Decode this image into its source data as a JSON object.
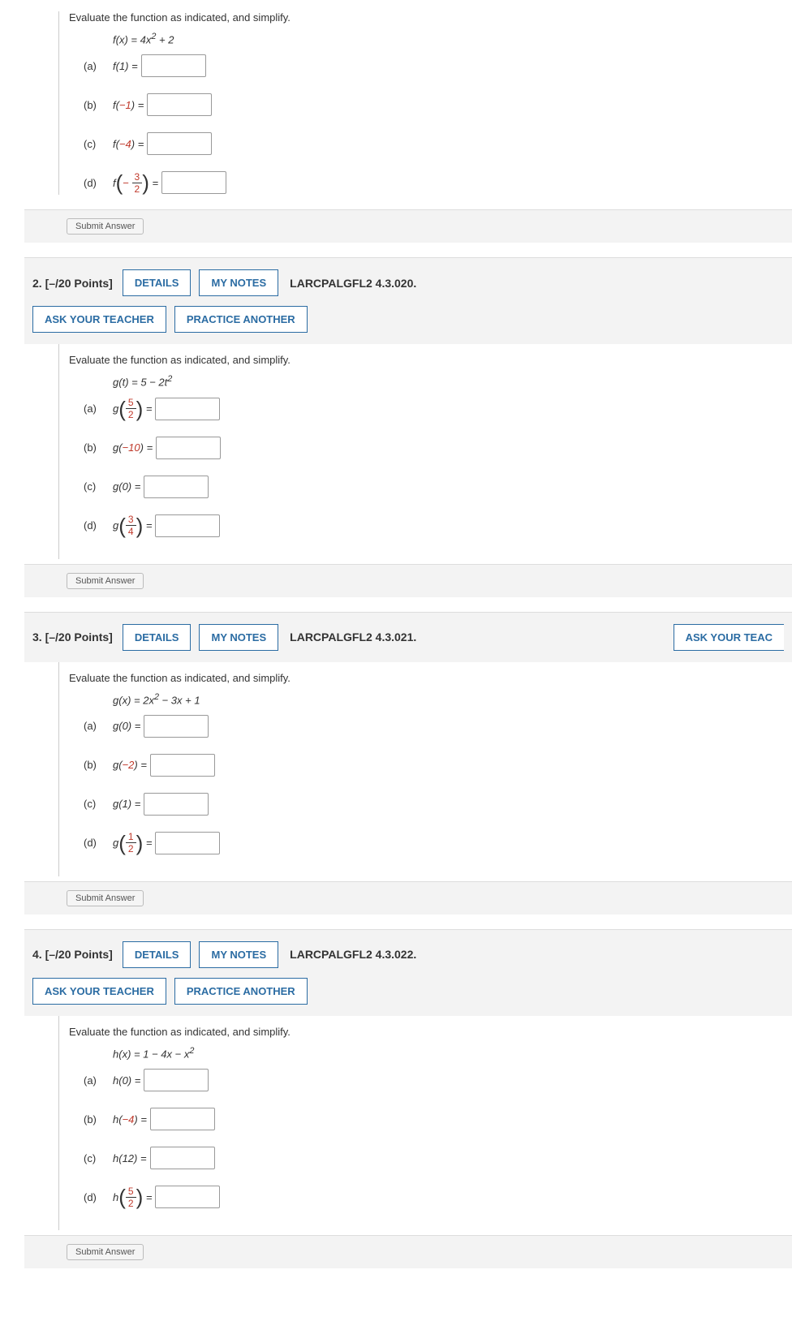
{
  "q1": {
    "intro": "Evaluate the function as indicated, and simplify.",
    "func_html": "f(x) = 4x² + 2",
    "a": "(a)",
    "a_expr": "f(1) =",
    "b": "(b)",
    "b_expr": "f(−1) =",
    "c": "(c)",
    "c_expr": "f(−4) =",
    "d": "(d)",
    "d_f": "f",
    "d_num": "3",
    "d_den": "2",
    "submit": "Submit Answer"
  },
  "q2": {
    "num": "2.",
    "points": "[–/20 Points]",
    "details": "DETAILS",
    "mynotes": "MY NOTES",
    "ref": "LARCPALGFL2 4.3.020.",
    "ask": "ASK YOUR TEACHER",
    "practice": "PRACTICE ANOTHER",
    "intro": "Evaluate the function as indicated, and simplify.",
    "func": "g(t) = 5 − 2t²",
    "a": "(a)",
    "a_g": "g",
    "a_num": "5",
    "a_den": "2",
    "b": "(b)",
    "b_expr": "g(−10) =",
    "c": "(c)",
    "c_expr": "g(0) =",
    "d": "(d)",
    "d_g": "g",
    "d_num": "3",
    "d_den": "4",
    "submit": "Submit Answer"
  },
  "q3": {
    "num": "3.",
    "points": "[–/20 Points]",
    "details": "DETAILS",
    "mynotes": "MY NOTES",
    "ref": "LARCPALGFL2 4.3.021.",
    "ask": "ASK YOUR TEAC",
    "intro": "Evaluate the function as indicated, and simplify.",
    "func": "g(x) = 2x² − 3x + 1",
    "a": "(a)",
    "a_expr": "g(0) =",
    "b": "(b)",
    "b_expr": "g(−2) =",
    "c": "(c)",
    "c_expr": "g(1) =",
    "d": "(d)",
    "d_g": "g",
    "d_num": "1",
    "d_den": "2",
    "submit": "Submit Answer"
  },
  "q4": {
    "num": "4.",
    "points": "[–/20 Points]",
    "details": "DETAILS",
    "mynotes": "MY NOTES",
    "ref": "LARCPALGFL2 4.3.022.",
    "ask": "ASK YOUR TEACHER",
    "practice": "PRACTICE ANOTHER",
    "intro": "Evaluate the function as indicated, and simplify.",
    "func": "h(x) = 1 − 4x − x²",
    "a": "(a)",
    "a_expr": "h(0) =",
    "b": "(b)",
    "b_expr": "h(−4) =",
    "c": "(c)",
    "c_expr": "h(12) =",
    "d": "(d)",
    "d_h": "h",
    "d_num": "5",
    "d_den": "2",
    "submit": "Submit Answer"
  }
}
